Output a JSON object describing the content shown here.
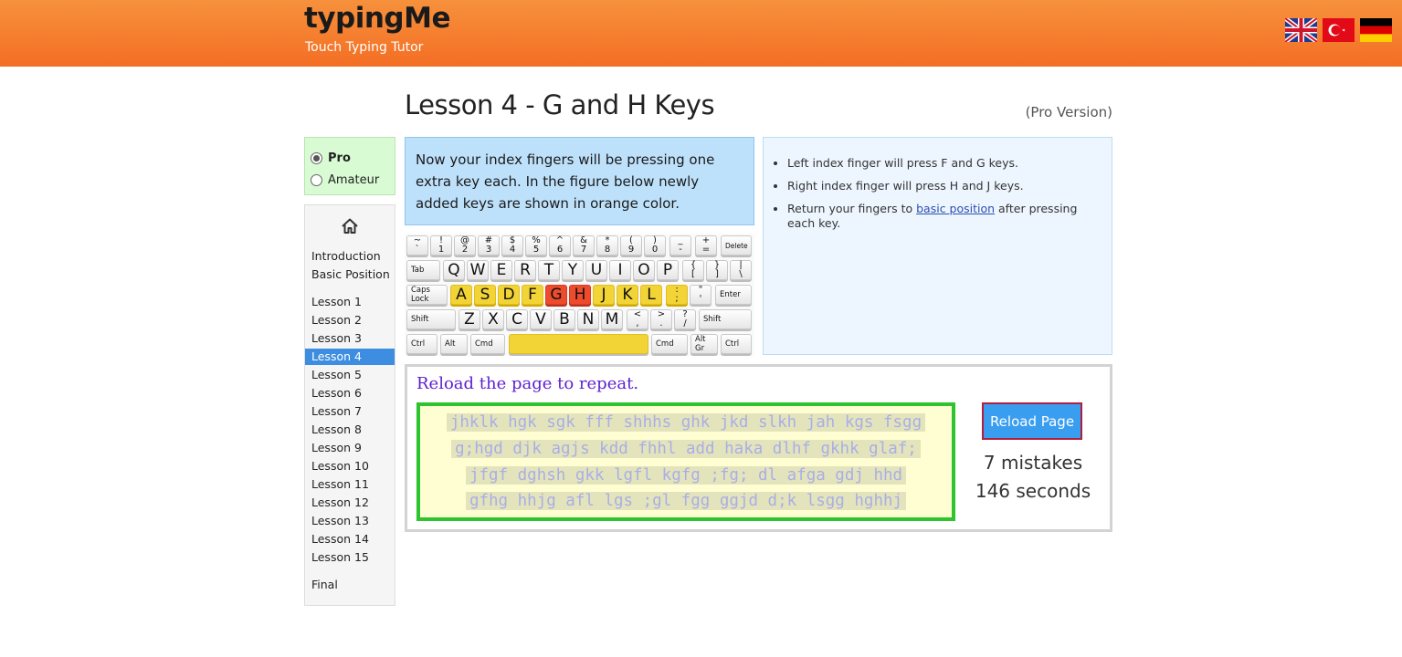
{
  "header": {
    "logo": "typingMe",
    "tagline": "Touch Typing Tutor",
    "flags": [
      "uk-flag-icon",
      "turkey-flag-icon",
      "germany-flag-icon"
    ],
    "colors": {
      "header_top": "#f6913c",
      "header_bottom": "#f46e24"
    }
  },
  "page": {
    "title": "Lesson 4 - G and H Keys",
    "pro_version": "(Pro Version)"
  },
  "mode": {
    "options": [
      {
        "label": "Pro",
        "selected": true
      },
      {
        "label": "Amateur",
        "selected": false
      }
    ]
  },
  "sidebar": {
    "home_icon": "home-icon",
    "items": [
      {
        "label": "Introduction"
      },
      {
        "label": "Basic Position"
      },
      {
        "label": "Lesson 1"
      },
      {
        "label": "Lesson 2"
      },
      {
        "label": "Lesson 3"
      },
      {
        "label": "Lesson 4",
        "active": true
      },
      {
        "label": "Lesson 5"
      },
      {
        "label": "Lesson 6"
      },
      {
        "label": "Lesson 7"
      },
      {
        "label": "Lesson 8"
      },
      {
        "label": "Lesson 9"
      },
      {
        "label": "Lesson 10"
      },
      {
        "label": "Lesson 11"
      },
      {
        "label": "Lesson 12"
      },
      {
        "label": "Lesson 13"
      },
      {
        "label": "Lesson 14"
      },
      {
        "label": "Lesson 15"
      },
      {
        "label": "Final"
      }
    ]
  },
  "intro": {
    "text": "Now your index fingers will be pressing one extra key each. In the figure below newly added keys are shown in orange color."
  },
  "tips": {
    "items": [
      "Left index finger will press F and G keys.",
      "Right index finger will press H and J keys."
    ],
    "return_prefix": "Return your fingers to ",
    "return_link": "basic position",
    "return_suffix": " after pressing each key."
  },
  "keyboard": {
    "number_row": [
      [
        "~",
        "`"
      ],
      [
        "!",
        "1"
      ],
      [
        "@",
        "2"
      ],
      [
        "#",
        "3"
      ],
      [
        "$",
        "4"
      ],
      [
        "%",
        "5"
      ],
      [
        "^",
        "6"
      ],
      [
        "&",
        "7"
      ],
      [
        "*",
        "8"
      ],
      [
        "(",
        "9"
      ],
      [
        ")",
        "0"
      ],
      [
        "_",
        "-"
      ],
      [
        "+",
        "="
      ]
    ],
    "delete": "Delete",
    "tab": "Tab",
    "top_row": [
      "Q",
      "W",
      "E",
      "R",
      "T",
      "Y",
      "U",
      "I",
      "O",
      "P"
    ],
    "top_row_symbols": [
      [
        "{",
        "["
      ],
      [
        "}",
        "]"
      ],
      [
        "|",
        "\\"
      ]
    ],
    "caps": "Caps Lock",
    "home_row": [
      "A",
      "S",
      "D",
      "F",
      "G",
      "H",
      "J",
      "K",
      "L"
    ],
    "home_row_symbols": [
      [
        ":",
        ";"
      ],
      [
        "\"",
        "'"
      ]
    ],
    "enter": "Enter",
    "shift": "Shift",
    "bottom_row": [
      "Z",
      "X",
      "C",
      "V",
      "B",
      "N",
      "M"
    ],
    "bottom_row_symbols": [
      [
        "<",
        ","
      ],
      [
        ">",
        "."
      ],
      [
        "?",
        "/"
      ]
    ],
    "ctrl": "Ctrl",
    "alt": "Alt",
    "cmd": "Cmd",
    "alt_gr": "Alt Gr",
    "colors": {
      "learned": "#f2d436",
      "new": "#ee4a2c"
    }
  },
  "practice": {
    "reload_text": "Reload the page to repeat.",
    "lines": [
      "jhklk hgk sgk fff shhhs ghk jkd slkh jah kgs fsgg",
      "g;hgd djk agjs kdd fhhl add haka dlhf gkhk glaf;",
      "jfgf dghsh gkk lgfl kgfg ;fg; dl afga gdj hhd",
      "gfhg hhjg afl lgs ;gl fgg ggjd d;k lsgg hghhj"
    ],
    "reload_button": "Reload Page",
    "mistakes": "7 mistakes",
    "seconds": "146 seconds"
  }
}
